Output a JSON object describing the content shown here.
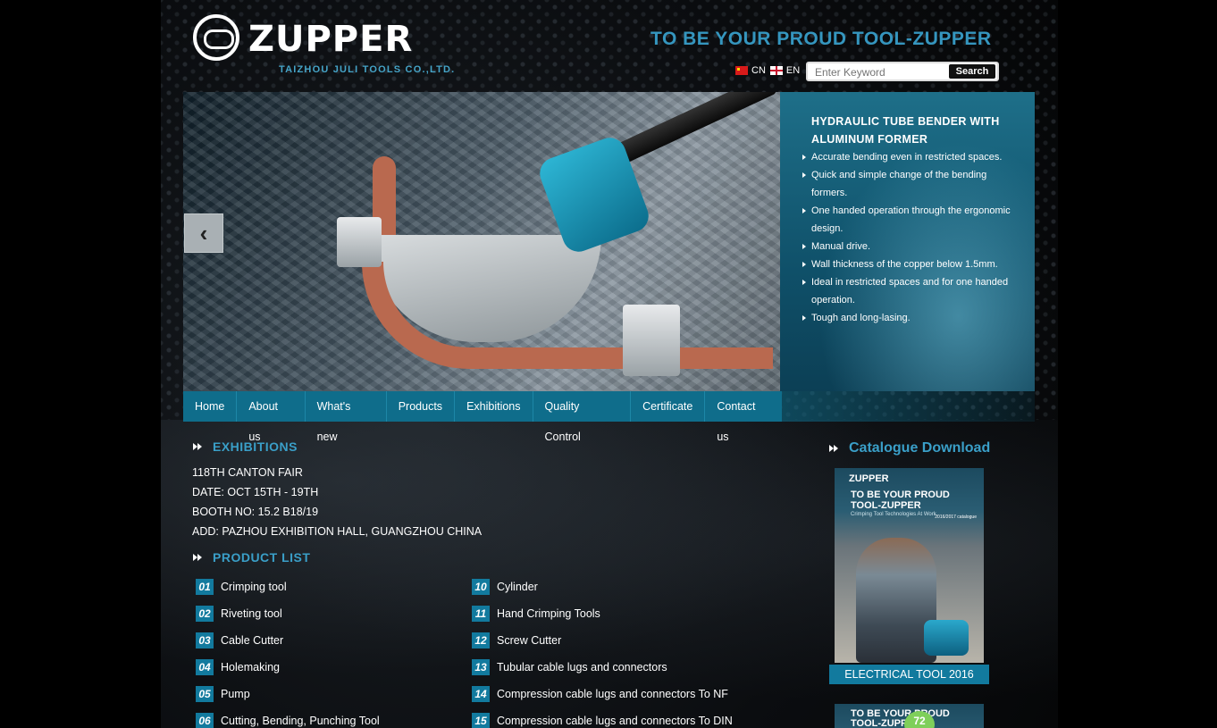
{
  "header": {
    "logo_word": "ZUPPER",
    "logo_sub": "TAIZHOU JULI TOOLS CO.,LTD.",
    "slogan": "TO BE YOUR PROUD TOOL-ZUPPER",
    "lang_cn": "CN",
    "lang_en": "EN",
    "search_placeholder": "Enter Keyword",
    "search_button": "Search"
  },
  "banner": {
    "title": "HYDRAULIC TUBE BENDER WITH ALUMINUM FORMER",
    "features": [
      "Accurate bending even in restricted spaces.",
      "Quick and simple change of the bending formers.",
      "One handed operation through the ergonomic design.",
      "Manual drive.",
      "Wall thickness of the copper below 1.5mm.",
      "Ideal in restricted spaces and for one handed operation.",
      "Tough and long-lasing."
    ],
    "prev_arrow": "‹"
  },
  "nav": [
    "Home",
    "About us",
    "What's new",
    "Products",
    "Exhibitions",
    "Quality Control",
    "Certificate",
    "Contact us"
  ],
  "exhibitions": {
    "heading": "EXHIBITIONS",
    "lines": [
      "118TH CANTON FAIR",
      "DATE: OCT 15TH - 19TH",
      "BOOTH NO: 15.2 B18/19",
      "ADD: PAZHOU EXHIBITION HALL, GUANGZHOU CHINA"
    ]
  },
  "product_list": {
    "heading": "PRODUCT LIST",
    "left": [
      {
        "num": "01",
        "label": "Crimping tool"
      },
      {
        "num": "02",
        "label": "Riveting tool"
      },
      {
        "num": "03",
        "label": "Cable Cutter"
      },
      {
        "num": "04",
        "label": "Holemaking"
      },
      {
        "num": "05",
        "label": "Pump"
      },
      {
        "num": "06",
        "label": "Cutting, Bending, Punching Tool"
      }
    ],
    "right": [
      {
        "num": "10",
        "label": "Cylinder"
      },
      {
        "num": "11",
        "label": "Hand Crimping Tools"
      },
      {
        "num": "12",
        "label": "Screw Cutter"
      },
      {
        "num": "13",
        "label": "Tubular cable lugs and connectors"
      },
      {
        "num": "14",
        "label": "Compression cable lugs and connectors To NF"
      },
      {
        "num": "15",
        "label": "Compression cable lugs and connectors To DIN"
      }
    ]
  },
  "catalogue": {
    "heading": "Catalogue Download",
    "card1_logo": "ZUPPER",
    "card1_head": "TO BE YOUR PROUD TOOL-ZUPPER",
    "card1_sub": "Crimping Tool Technologies At Work",
    "card1_year": "2016/2017 catalogue",
    "card1_label": "ELECTRICAL TOOL 2016",
    "card2_head": "TO BE YOUR PROUD TOOL-ZUPPER",
    "card2_badge": "72"
  },
  "colors": {
    "accent": "#3596bf",
    "nav_bg": "#0f6d8b",
    "num_bg": "#127a9e",
    "background": "#000000"
  },
  "icons": {
    "prev": "chevron-left-icon",
    "bullet": "triangle-right-icon",
    "section": "double-chevron-right-icon"
  }
}
